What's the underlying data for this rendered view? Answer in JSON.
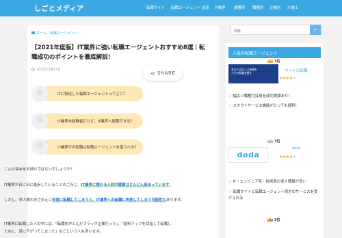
{
  "header": {
    "logo": "しごとメディア",
    "nav": [
      "転職サイト",
      "転職エージェント",
      "派遣",
      "IT業界",
      "業種別",
      "職種別",
      "企業別",
      "介護士"
    ]
  },
  "article": {
    "breadcrumb": [
      "ホーム",
      "転職エージェント"
    ],
    "title": "【2021年度版】IT業界に強い転職エージェントおすすめ8選｜転職成功のポイントを徹底解説！",
    "date": "2021年3月17日",
    "share_label": "SHARE",
    "bubbles": [
      "ITに特化した転職エージェントってどこ？",
      "IT業界未経験者だけど、IT業界へ転職できる？",
      "IT業界での転職は転職エージェントを使うべき？"
    ],
    "p1": "こんな悩みをお持ちではないでしょうか？",
    "p2_before": "IT業界が日に日に進歩していることのご存じ、",
    "p2_highlight": "IT業界に携わる人材の需要はどんどん高まっています",
    "p2_after": "。",
    "p3_before": "しかし、求人数の多さゆえに",
    "p3_highlight": "安易に転職してしまうと、IT業界への転職に失敗してしまう可能性も",
    "p3_after": "あります。",
    "p4_line1": "IT業界に転職した人の中には、「転職先がとんだブラック企業だった」、「給料アップを目指して転職し",
    "p4_line2": "たのに、逆に下がってしまった」などという人も多います。"
  },
  "sidebar": {
    "search_placeholder": "検索",
    "popular_title": "人気の転職エージェント",
    "rank1": {
      "label": "1位",
      "name": "マイナビ転職",
      "thumb_line1": "あなたの正しい転職を",
      "thumb_line2": "人生の転職支援を",
      "rating_label": "",
      "stars": 4.5
    },
    "rank1_bullets": [
      "幅広い職種で採用を成功実績あり！",
      "スカウトサービス機能がとっても便利！"
    ],
    "rank2": {
      "label": "2位",
      "name": "doda",
      "logo_text": "doda",
      "stars": 4.0
    },
    "rank2_bullets": [
      "IT・エンジニア系・技術系の求人情報が多い",
      "転職サイトと転職エージェント両方のサービスを受けられる"
    ],
    "rank3": {
      "label": "3位"
    }
  },
  "colors": {
    "brand": "#3aa9e3",
    "bubble": "#fde8b6",
    "highlight_text": "#1f6fd6",
    "marker": "#c8f0b0",
    "stars": "#f2a900"
  }
}
